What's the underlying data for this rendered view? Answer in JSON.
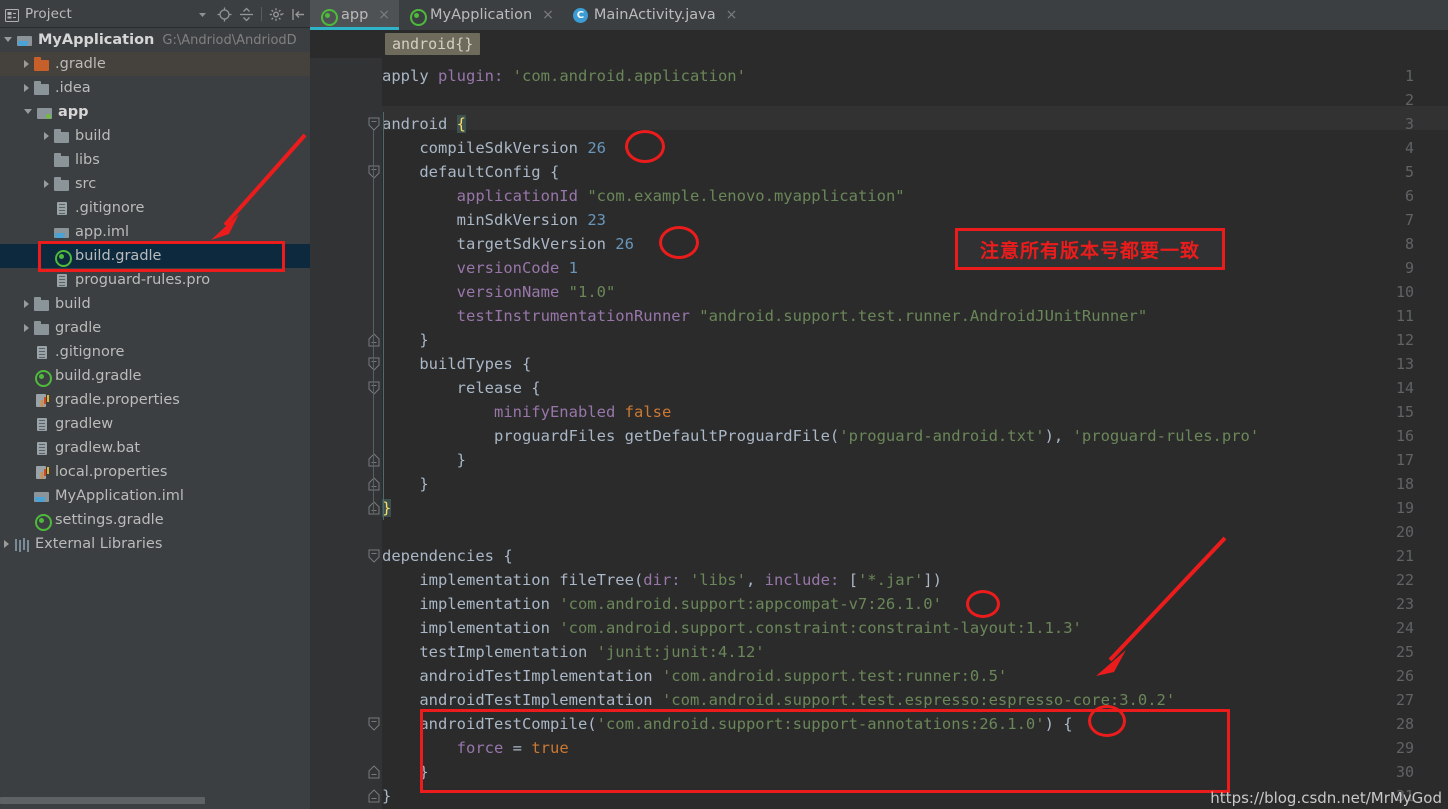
{
  "sidebar": {
    "title": "Project",
    "tools": [
      "chevron-down-icon",
      "locate-icon",
      "collapse-all-icon",
      "settings-icon",
      "hide-panel-icon"
    ],
    "root": {
      "label": "MyApplication",
      "path": "G:\\Andriod\\AndriodD"
    },
    "items": [
      {
        "label": ".gradle",
        "icon": "folder-orange-icon",
        "indent": 1,
        "arrow": "closed",
        "state": "hover"
      },
      {
        "label": ".idea",
        "icon": "folder-icon",
        "indent": 1,
        "arrow": "closed",
        "state": ""
      },
      {
        "label": "app",
        "icon": "module-icon",
        "indent": 1,
        "arrow": "open",
        "state": "bold"
      },
      {
        "label": "build",
        "icon": "folder-icon",
        "indent": 2,
        "arrow": "closed",
        "state": ""
      },
      {
        "label": "libs",
        "icon": "folder-icon",
        "indent": 2,
        "arrow": "none",
        "state": ""
      },
      {
        "label": "src",
        "icon": "folder-icon",
        "indent": 2,
        "arrow": "closed",
        "state": ""
      },
      {
        "label": ".gitignore",
        "icon": "text-file-icon",
        "indent": 2,
        "arrow": "none",
        "state": ""
      },
      {
        "label": "app.iml",
        "icon": "iml-file-icon",
        "indent": 2,
        "arrow": "none",
        "state": ""
      },
      {
        "label": "build.gradle",
        "icon": "gradle-file-icon",
        "indent": 2,
        "arrow": "none",
        "state": "selected"
      },
      {
        "label": "proguard-rules.pro",
        "icon": "text-file-icon",
        "indent": 2,
        "arrow": "none",
        "state": ""
      },
      {
        "label": "build",
        "icon": "folder-icon",
        "indent": 1,
        "arrow": "closed",
        "state": ""
      },
      {
        "label": "gradle",
        "icon": "folder-icon",
        "indent": 1,
        "arrow": "closed",
        "state": ""
      },
      {
        "label": ".gitignore",
        "icon": "text-file-icon",
        "indent": 1,
        "arrow": "none",
        "state": ""
      },
      {
        "label": "build.gradle",
        "icon": "gradle-file-icon",
        "indent": 1,
        "arrow": "none",
        "state": ""
      },
      {
        "label": "gradle.properties",
        "icon": "properties-file-icon",
        "indent": 1,
        "arrow": "none",
        "state": ""
      },
      {
        "label": "gradlew",
        "icon": "text-file-icon",
        "indent": 1,
        "arrow": "none",
        "state": ""
      },
      {
        "label": "gradlew.bat",
        "icon": "text-file-icon",
        "indent": 1,
        "arrow": "none",
        "state": ""
      },
      {
        "label": "local.properties",
        "icon": "properties-file-icon",
        "indent": 1,
        "arrow": "none",
        "state": ""
      },
      {
        "label": "MyApplication.iml",
        "icon": "iml-file-icon",
        "indent": 1,
        "arrow": "none",
        "state": ""
      },
      {
        "label": "settings.gradle",
        "icon": "gradle-file-icon",
        "indent": 1,
        "arrow": "none",
        "state": ""
      },
      {
        "label": "External Libraries",
        "icon": "libraries-icon",
        "indent": 0,
        "arrow": "closed",
        "state": ""
      }
    ]
  },
  "editor": {
    "tabs": [
      {
        "label": "app",
        "icon": "gradle-file-icon",
        "active": true,
        "close": "×"
      },
      {
        "label": "MyApplication",
        "icon": "gradle-file-icon",
        "active": false,
        "close": "×"
      },
      {
        "label": "MainActivity.java",
        "icon": "java-class-icon",
        "active": false,
        "close": "×"
      }
    ],
    "breadcrumb": "android{}",
    "line_numbers": [
      1,
      2,
      3,
      4,
      5,
      6,
      7,
      8,
      9,
      10,
      11,
      12,
      13,
      14,
      15,
      16,
      17,
      18,
      19,
      20,
      21,
      22,
      23,
      24,
      25,
      26,
      27,
      28,
      29,
      30,
      31
    ],
    "code": [
      {
        "n": 1,
        "html": "<span class=\"plain\">apply </span><span class=\"prop\">plugin:</span><span class=\"plain\"> </span><span class=\"str\">'com.android.application'</span>"
      },
      {
        "n": 2,
        "html": ""
      },
      {
        "n": 3,
        "html": "<span class=\"plain\">android </span><span class=\"brace-hl\">{</span>"
      },
      {
        "n": 4,
        "html": "<span class=\"plain\">    compileSdkVersion </span><span class=\"num\">26</span>"
      },
      {
        "n": 5,
        "html": "<span class=\"plain\">    defaultConfig {</span>"
      },
      {
        "n": 6,
        "html": "<span class=\"plain\">        </span><span class=\"prop\">applicationId</span><span class=\"plain\"> </span><span class=\"str\">\"com.example.lenovo.myapplication\"</span>"
      },
      {
        "n": 7,
        "html": "<span class=\"plain\">        minSdkVersion </span><span class=\"num\">23</span>"
      },
      {
        "n": 8,
        "html": "<span class=\"plain\">        targetSdkVersion </span><span class=\"num\">26</span>"
      },
      {
        "n": 9,
        "html": "<span class=\"plain\">        </span><span class=\"prop\">versionCode</span><span class=\"plain\"> </span><span class=\"num\">1</span>"
      },
      {
        "n": 10,
        "html": "<span class=\"plain\">        </span><span class=\"prop\">versionName</span><span class=\"plain\"> </span><span class=\"str\">\"1.0\"</span>"
      },
      {
        "n": 11,
        "html": "<span class=\"plain\">        </span><span class=\"prop\">testInstrumentationRunner</span><span class=\"plain\"> </span><span class=\"str\">\"android.support.test.runner.AndroidJUnitRunner\"</span>"
      },
      {
        "n": 12,
        "html": "<span class=\"plain\">    }</span>"
      },
      {
        "n": 13,
        "html": "<span class=\"plain\">    buildTypes {</span>"
      },
      {
        "n": 14,
        "html": "<span class=\"plain\">        release {</span>"
      },
      {
        "n": 15,
        "html": "<span class=\"plain\">            </span><span class=\"prop\">minifyEnabled</span><span class=\"plain\"> </span><span class=\"kw\">false</span>"
      },
      {
        "n": 16,
        "html": "<span class=\"plain\">            proguardFiles getDefaultProguardFile(</span><span class=\"str\">'proguard-android.txt'</span><span class=\"plain\">), </span><span class=\"str\">'proguard-rules.pro'</span>"
      },
      {
        "n": 17,
        "html": "<span class=\"plain\">        }</span>"
      },
      {
        "n": 18,
        "html": "<span class=\"plain\">    }</span>"
      },
      {
        "n": 19,
        "html": "<span class=\"brace-hl\">}</span>"
      },
      {
        "n": 20,
        "html": ""
      },
      {
        "n": 21,
        "html": "<span class=\"plain\">dependencies {</span>"
      },
      {
        "n": 22,
        "html": "<span class=\"plain\">    implementation fileTree(</span><span class=\"prop\">dir:</span><span class=\"plain\"> </span><span class=\"str\">'libs'</span><span class=\"plain\">, </span><span class=\"prop\">include:</span><span class=\"plain\"> [</span><span class=\"str\">'*.jar'</span><span class=\"plain\">])</span>"
      },
      {
        "n": 23,
        "html": "<span class=\"plain\">    implementation </span><span class=\"str\">'com.android.support:appcompat-v7:26.1.0'</span>"
      },
      {
        "n": 24,
        "html": "<span class=\"plain\">    implementation </span><span class=\"str\">'com.android.support.constraint:constraint-layout:1.1.3'</span>"
      },
      {
        "n": 25,
        "html": "<span class=\"plain\">    testImplementation </span><span class=\"str\">'junit:junit:4.12'</span>"
      },
      {
        "n": 26,
        "html": "<span class=\"plain\">    androidTestImplementation </span><span class=\"str\">'com.android.support.test:runner:0.5'</span>"
      },
      {
        "n": 27,
        "html": "<span class=\"plain\">    androidTestImplementation </span><span class=\"str\">'com.android.support.test.espresso:espresso-core:3.0.2'</span>"
      },
      {
        "n": 28,
        "html": "<span class=\"plain\">    androidTestCompile(</span><span class=\"str\">'com.android.support:support-annotations:26.1.0'</span><span class=\"plain\">) {</span>"
      },
      {
        "n": 29,
        "html": "<span class=\"plain\">        </span><span class=\"prop\">force</span><span class=\"plain\"> = </span><span class=\"kw\">true</span>"
      },
      {
        "n": 30,
        "html": "<span class=\"plain\">    }</span>"
      },
      {
        "n": 31,
        "html": "<span class=\"plain\">}</span>"
      }
    ]
  },
  "annotations": {
    "note_text": "注意所有版本号都要一致",
    "accent_color": "#ec1c1c",
    "circles": [
      "26",
      "26",
      "26",
      "26"
    ],
    "watermark": "https://blog.csdn.net/MrMyGod"
  },
  "colors": {
    "editor_bg": "#2b2b2b",
    "panel_bg": "#3c3f41",
    "gutter_bg": "#313335",
    "selection_bg": "#0d293e",
    "tab_active_underline": "#2fb3c9",
    "string": "#6a8759",
    "number": "#6897bb",
    "keyword": "#cc7832",
    "property": "#9876aa",
    "text": "#a9b7c6"
  }
}
